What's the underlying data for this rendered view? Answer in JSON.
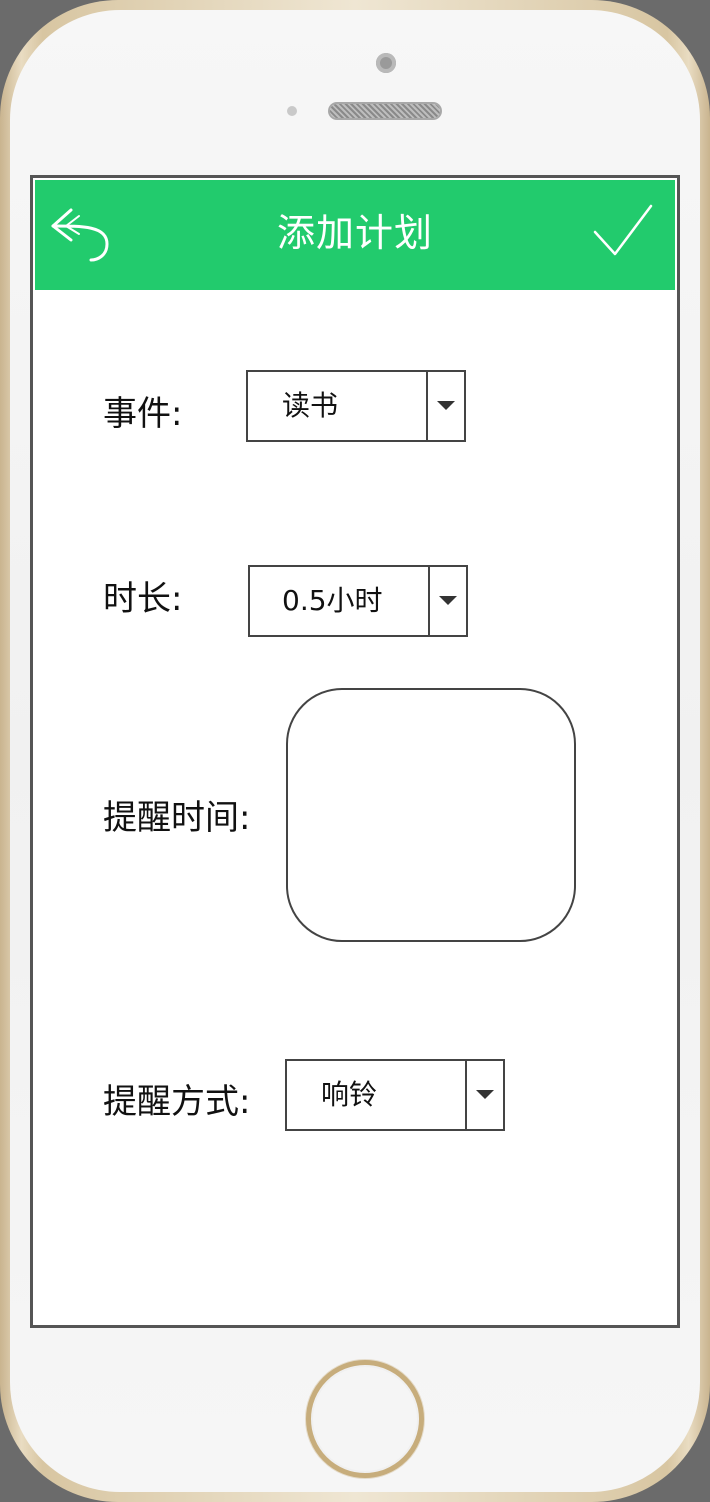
{
  "header": {
    "title": "添加计划",
    "back_icon": "back-arrow-icon",
    "confirm_icon": "checkmark-icon",
    "color": "#22cb6d"
  },
  "form": {
    "event": {
      "label": "事件:",
      "value": "读书"
    },
    "duration": {
      "label": "时长:",
      "value": "0.5小时"
    },
    "reminder_time": {
      "label": "提醒时间:",
      "value": ""
    },
    "reminder_method": {
      "label": "提醒方式:",
      "value": "响铃"
    }
  },
  "icons": {
    "dropdown": "caret-down-icon"
  }
}
